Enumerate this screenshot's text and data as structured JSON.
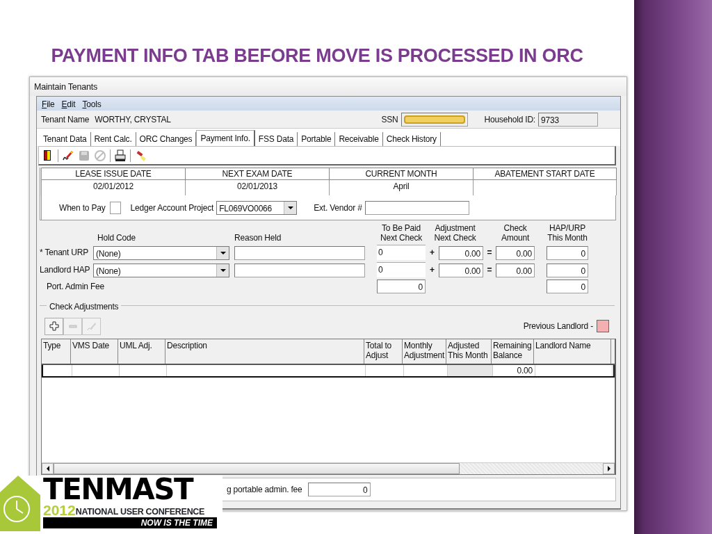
{
  "slide_title": "PAYMENT INFO TAB BEFORE MOVE IS PROCESSED IN ORC",
  "window": {
    "title": "Maintain Tenants"
  },
  "menu": [
    "File",
    "Edit",
    "Tools"
  ],
  "tenant": {
    "name_label": "Tenant Name",
    "name": "WORTHY, CRYSTAL",
    "ssn_label": "SSN",
    "household_label": "Household ID:",
    "household_id": "9733"
  },
  "tabs": [
    {
      "label": "Tenant Data",
      "selected": false
    },
    {
      "label": "Rent Calc.",
      "selected": false
    },
    {
      "label": "ORC Changes",
      "selected": false
    },
    {
      "label": "Payment Info.",
      "selected": true
    },
    {
      "label": "FSS Data",
      "selected": false
    },
    {
      "label": "Portable",
      "selected": false
    },
    {
      "label": "Receivable",
      "selected": false
    },
    {
      "label": "Check History",
      "selected": false
    }
  ],
  "toolbar": [
    {
      "kind": "exit",
      "disabled": false,
      "separator_before": false
    },
    {
      "kind": "edit",
      "disabled": false,
      "separator_before": true
    },
    {
      "kind": "save",
      "disabled": true,
      "separator_before": false
    },
    {
      "kind": "cancel",
      "disabled": true,
      "separator_before": false
    },
    {
      "kind": "print",
      "disabled": false,
      "separator_before": true
    },
    {
      "kind": "highlight",
      "disabled": false,
      "separator_before": true
    }
  ],
  "dates": [
    {
      "heading": "LEASE ISSUE DATE",
      "value": "02/01/2012"
    },
    {
      "heading": "NEXT EXAM DATE",
      "value": "02/01/2013"
    },
    {
      "heading": "CURRENT MONTH",
      "value": "April"
    },
    {
      "heading": "ABATEMENT START DATE"
    }
  ],
  "when_to_pay": {
    "label": "When to Pay",
    "checked": false
  },
  "ledger": {
    "label": "Ledger Account Project",
    "value": "FL069VO0066"
  },
  "vendor": {
    "label": "Ext. Vendor #"
  },
  "payment": {
    "headings": {
      "hold_code": "Hold Code",
      "reason_held": "Reason Held",
      "to_be_paid": "To Be Paid Next Check",
      "adjustment": "Adjustment Next Check",
      "check_amount": "Check Amount",
      "hap_urp": "HAP/URP This Month"
    },
    "rows": [
      {
        "kind": "full",
        "label": "* Tenant URP",
        "hold_code": "(None)",
        "to_be_paid": "0",
        "plus": "+",
        "adjustment": "0.00",
        "equals": "=",
        "check_amount": "0.00",
        "hap_urp": "0"
      },
      {
        "kind": "full",
        "label": "Landlord HAP",
        "hold_code": "(None)",
        "to_be_paid": "0",
        "plus": "+",
        "adjustment": "0.00",
        "equals": "=",
        "check_amount": "0.00",
        "hap_urp": "0"
      },
      {
        "kind": "fee",
        "label": "Port. Admin Fee",
        "to_be_paid": "0",
        "hap_urp": "0"
      }
    ]
  },
  "check_adjustments": {
    "title": "Check Adjustments",
    "buttons": [
      {
        "kind": "add",
        "disabled": false
      },
      {
        "kind": "remove",
        "disabled": true
      },
      {
        "kind": "edit",
        "disabled": true
      }
    ],
    "previous_landlord_label": "Previous Landlord -"
  },
  "table": {
    "columns": [
      "Type",
      "VMS Date",
      "UML Adj.",
      "Description",
      "Total to Adjust",
      "Monthly Adjustment",
      "Adjusted This Month",
      "Remaining Balance",
      "Landlord Name"
    ],
    "rows": [
      {
        "remaining_balance": "0.00"
      }
    ]
  },
  "footer": {
    "label": "g portable admin. fee",
    "value": "0"
  },
  "logo": {
    "name": "TENMAST",
    "year": "2012",
    "subtitle": "NATIONAL USER CONFERENCE",
    "tagline": "NOW IS THE TIME"
  }
}
